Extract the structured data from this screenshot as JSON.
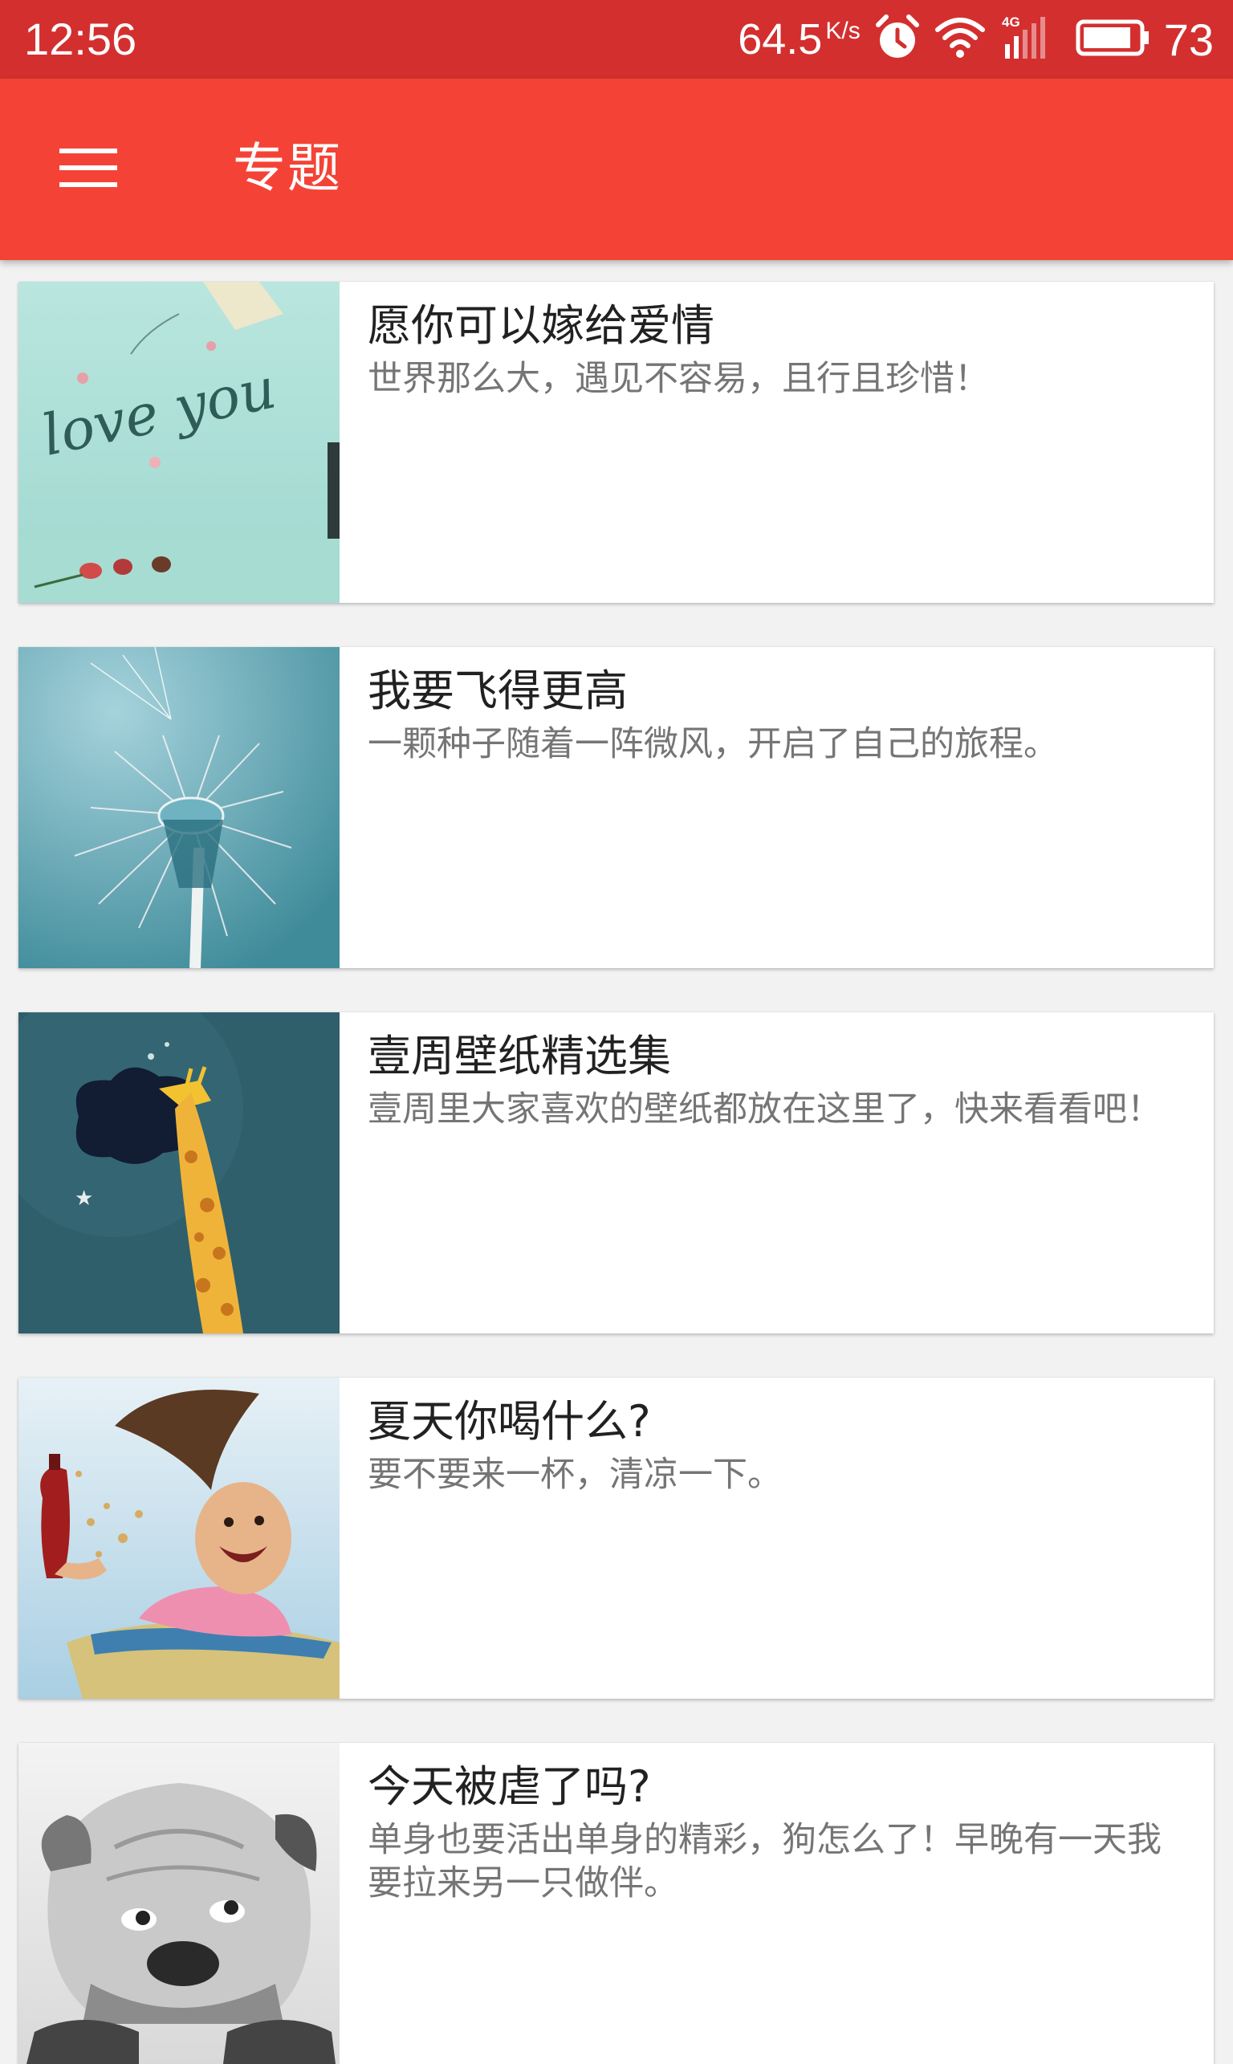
{
  "status_bar": {
    "time": "12:56",
    "net_speed": "64.5",
    "net_speed_unit": "K/s",
    "network_type": "4G",
    "battery": "73",
    "icons": [
      "alarm-icon",
      "wifi-icon",
      "signal-4g-icon",
      "battery-icon"
    ]
  },
  "app_bar": {
    "title": "专题",
    "menu_icon": "hamburger-menu-icon"
  },
  "topics": [
    {
      "title": "愿你可以嫁给爱情",
      "description": "世界那么大，遇见不容易，且行且珍惜！",
      "image_text": "love you"
    },
    {
      "title": "我要飞得更高",
      "description": "一颗种子随着一阵微风，开启了自己的旅程。"
    },
    {
      "title": "壹周壁纸精选集",
      "description": "壹周里大家喜欢的壁纸都放在这里了，快来看看吧！"
    },
    {
      "title": "夏天你喝什么?",
      "description": "要不要来一杯，清凉一下。"
    },
    {
      "title": "今天被虐了吗?",
      "description": "单身也要活出单身的精彩，狗怎么了！早晚有一天我要拉来另一只做伴。"
    }
  ],
  "colors": {
    "status_bar": "#d32f2f",
    "app_bar": "#f44336",
    "title_text": "#212121",
    "desc_text": "#757575",
    "background": "#f2f2f2"
  }
}
